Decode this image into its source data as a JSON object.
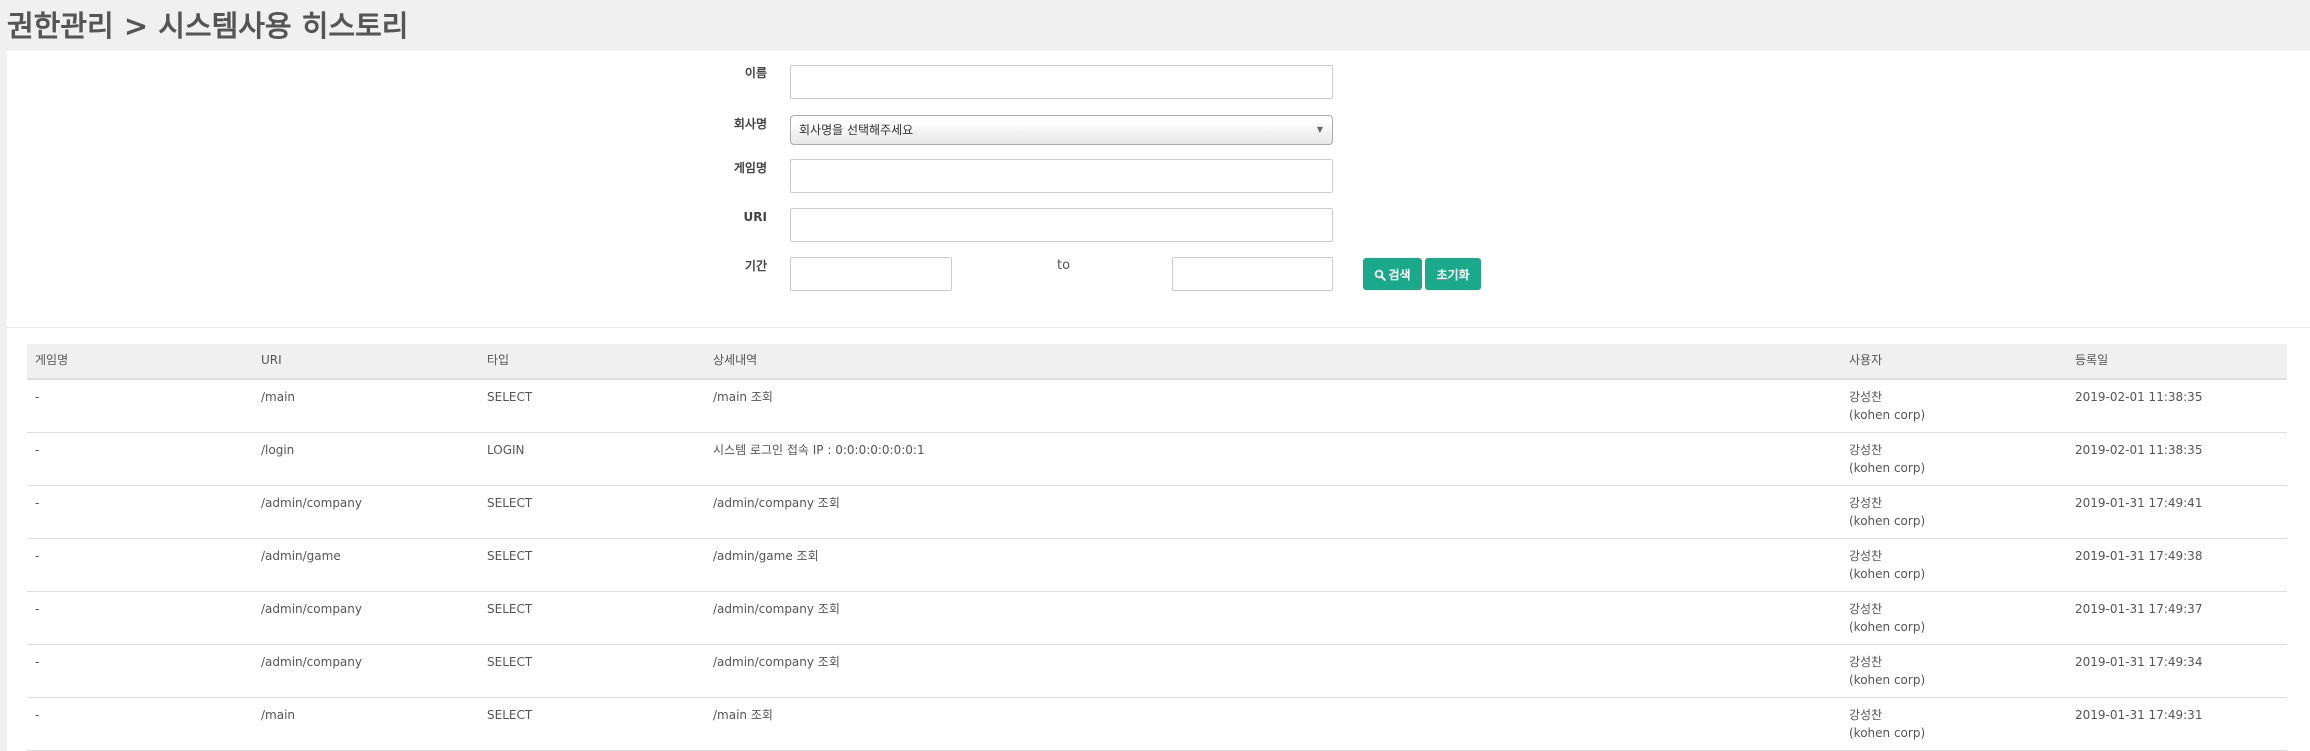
{
  "page": {
    "title": "권한관리 > 시스템사용 히스토리"
  },
  "search": {
    "name_label": "이름",
    "name_value": "",
    "company_label": "회사명",
    "company_selected": "회사명을 선택해주세요",
    "game_label": "게임명",
    "game_value": "",
    "uri_label": "URI",
    "uri_value": "",
    "period_label": "기간",
    "period_from": "",
    "to_label": "to",
    "period_to": "",
    "search_button": "검색",
    "reset_button": "초기화",
    "accent_color": "#1aa98a"
  },
  "table": {
    "headers": [
      "게임명",
      "URI",
      "타입",
      "상세내역",
      "사용자",
      "등록일"
    ],
    "rows": [
      {
        "game": "-",
        "uri": "/main",
        "type": "SELECT",
        "detail": "/main 조회",
        "user_name": "강성찬",
        "user_company": "(kohen corp)",
        "date": "2019-02-01 11:38:35"
      },
      {
        "game": "-",
        "uri": "/login",
        "type": "LOGIN",
        "detail": "시스템 로그인 접속 IP : 0:0:0:0:0:0:0:1",
        "user_name": "강성찬",
        "user_company": "(kohen corp)",
        "date": "2019-02-01 11:38:35"
      },
      {
        "game": "-",
        "uri": "/admin/company",
        "type": "SELECT",
        "detail": "/admin/company 조회",
        "user_name": "강성찬",
        "user_company": "(kohen corp)",
        "date": "2019-01-31 17:49:41"
      },
      {
        "game": "-",
        "uri": "/admin/game",
        "type": "SELECT",
        "detail": "/admin/game 조회",
        "user_name": "강성찬",
        "user_company": "(kohen corp)",
        "date": "2019-01-31 17:49:38"
      },
      {
        "game": "-",
        "uri": "/admin/company",
        "type": "SELECT",
        "detail": "/admin/company 조회",
        "user_name": "강성찬",
        "user_company": "(kohen corp)",
        "date": "2019-01-31 17:49:37"
      },
      {
        "game": "-",
        "uri": "/admin/company",
        "type": "SELECT",
        "detail": "/admin/company 조회",
        "user_name": "강성찬",
        "user_company": "(kohen corp)",
        "date": "2019-01-31 17:49:34"
      },
      {
        "game": "-",
        "uri": "/main",
        "type": "SELECT",
        "detail": "/main 조회",
        "user_name": "강성찬",
        "user_company": "(kohen corp)",
        "date": "2019-01-31 17:49:31"
      }
    ]
  },
  "icons": {
    "search_button_icon": "search-icon",
    "select_arrow_icon": "caret-down-icon"
  }
}
